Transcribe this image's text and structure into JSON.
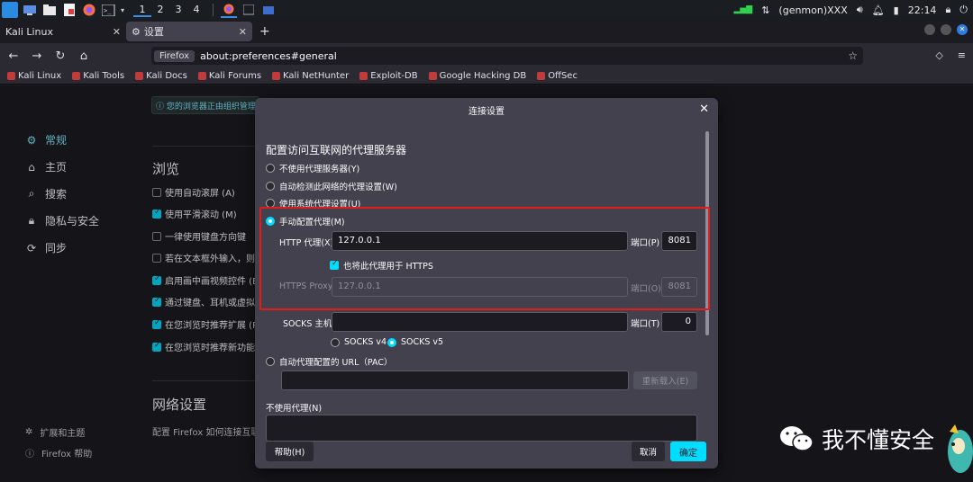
{
  "taskbar": {
    "workspaces": [
      "1",
      "2",
      "3",
      "4"
    ],
    "user": "(genmon)XXX",
    "time": "22:14"
  },
  "tabs": [
    {
      "label": "Kali Linux"
    },
    {
      "label": "设置"
    }
  ],
  "nav": {
    "identity": "Firefox",
    "url": "about:preferences#general"
  },
  "bookmarks": [
    "Kali Linux",
    "Kali Tools",
    "Kali Docs",
    "Kali Forums",
    "Kali NetHunter",
    "Exploit-DB",
    "Google Hacking DB",
    "OffSec"
  ],
  "sidebar": {
    "items": [
      {
        "label": "常规",
        "icon": "gear-icon"
      },
      {
        "label": "主页",
        "icon": "home-icon"
      },
      {
        "label": "搜索",
        "icon": "search-icon"
      },
      {
        "label": "隐私与安全",
        "icon": "lock-icon"
      },
      {
        "label": "同步",
        "icon": "sync-icon"
      }
    ],
    "footer": [
      {
        "label": "扩展和主题",
        "icon": "puzzle-icon"
      },
      {
        "label": "Firefox 帮助",
        "icon": "help-icon"
      }
    ]
  },
  "main": {
    "notice": "您的浏览器正由组织管理",
    "browse_title": "浏览",
    "options": [
      {
        "label": "使用自动滚屏 (A)",
        "checked": false
      },
      {
        "label": "使用平滑滚动 (M)",
        "checked": true
      },
      {
        "label": "一律使用键盘方向键",
        "checked": false
      },
      {
        "label": "若在文本框外输入，则",
        "checked": false
      },
      {
        "label": "启用画中画视频控件 (E",
        "checked": true
      },
      {
        "label": "通过键盘、耳机或虚拟",
        "checked": true
      },
      {
        "label": "在您浏览时推荐扩展 (R",
        "checked": true
      },
      {
        "label": "在您浏览时推荐新功能",
        "checked": true
      }
    ],
    "network_title": "网络设置",
    "network_desc": "配置 Firefox 如何连接互联网"
  },
  "dialog": {
    "title": "连接设置",
    "heading": "配置访问互联网的代理服务器",
    "radios": [
      {
        "label": "不使用代理服务器(Y)",
        "selected": false
      },
      {
        "label": "自动检测此网络的代理设置(W)",
        "selected": false
      },
      {
        "label": "使用系统代理设置(U)",
        "selected": false
      },
      {
        "label": "手动配置代理(M)",
        "selected": true
      }
    ],
    "http": {
      "label": "HTTP 代理(X)",
      "value": "127.0.0.1",
      "port_label": "端口(P)",
      "port": "8081"
    },
    "also_https": {
      "label": "也将此代理用于 HTTPS",
      "checked": true
    },
    "https": {
      "label": "HTTPS Proxy",
      "value": "127.0.0.1",
      "port_label": "端口(O)",
      "port": "8081"
    },
    "socks": {
      "label": "SOCKS 主机",
      "value": "",
      "port_label": "端口(T)",
      "port": "0"
    },
    "socks_versions": [
      {
        "label": "SOCKS v4",
        "selected": false
      },
      {
        "label": "SOCKS v5",
        "selected": true
      }
    ],
    "pac": {
      "label": "自动代理配置的 URL（PAC）",
      "value": "",
      "reload": "重新载入(E)"
    },
    "no_proxy_label": "不使用代理(N)",
    "help_button": "帮助(H)",
    "cancel_button": "取消",
    "ok_button": "确定"
  },
  "watermark": {
    "text": "我不懂安全"
  },
  "colors": {
    "accent": "#00ddff",
    "highlight": "#e21b1b",
    "dialog_bg": "#42414d",
    "page_bg": "#1c1b22"
  }
}
